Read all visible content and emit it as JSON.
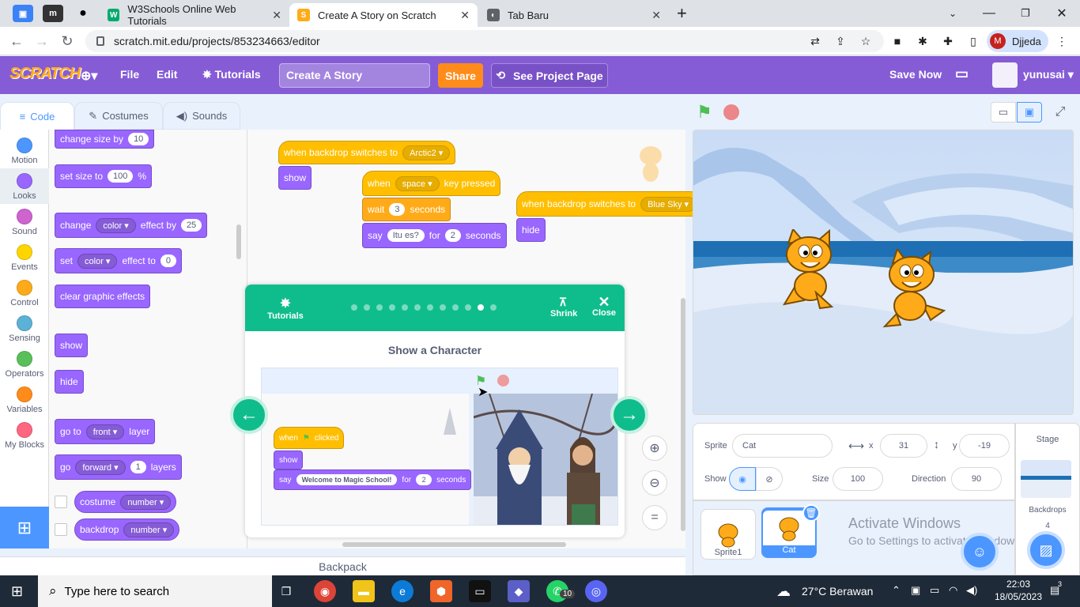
{
  "browser": {
    "tabs": [
      {
        "title": "W3Schools Online Web Tutorials",
        "fav": "W"
      },
      {
        "title": "Create A Story on Scratch",
        "fav": "S"
      },
      {
        "title": "Tab Baru",
        "fav": "◐"
      }
    ],
    "url": "scratch.mit.edu/projects/853234663/editor",
    "profile_initial": "M",
    "profile_name": "Djjeda"
  },
  "menubar": {
    "logo": "SCRATCH",
    "file": "File",
    "edit": "Edit",
    "tutorials": "Tutorials",
    "project_title": "Create A Story",
    "share": "Share",
    "see_project_page": "See Project Page",
    "save_now": "Save Now",
    "username": "yunusai"
  },
  "editor_tabs": {
    "code": "Code",
    "costumes": "Costumes",
    "sounds": "Sounds"
  },
  "categories": [
    {
      "label": "Motion",
      "color": "#4c97ff"
    },
    {
      "label": "Looks",
      "color": "#9966ff"
    },
    {
      "label": "Sound",
      "color": "#cf63cf"
    },
    {
      "label": "Events",
      "color": "#ffd500"
    },
    {
      "label": "Control",
      "color": "#ffab19"
    },
    {
      "label": "Sensing",
      "color": "#5cb1d6"
    },
    {
      "label": "Operators",
      "color": "#59c059"
    },
    {
      "label": "Variables",
      "color": "#ff8c1a"
    },
    {
      "label": "My Blocks",
      "color": "#ff6680"
    }
  ],
  "palette": {
    "change_size": {
      "text": "change size by",
      "value": "10"
    },
    "set_size": {
      "text": "set size to",
      "value": "100",
      "unit": "%"
    },
    "change_effect": {
      "a": "change",
      "drop": "color",
      "b": "effect by",
      "value": "25"
    },
    "set_effect": {
      "a": "set",
      "drop": "color",
      "b": "effect to",
      "value": "0"
    },
    "clear_effects": "clear graphic effects",
    "show": "show",
    "hide": "hide",
    "go_to": {
      "a": "go to",
      "drop": "front",
      "b": "layer"
    },
    "go_layers": {
      "a": "go",
      "drop": "forward",
      "value": "1",
      "b": "layers"
    },
    "costume": {
      "a": "costume",
      "drop": "number"
    },
    "backdrop": {
      "a": "backdrop",
      "drop": "number"
    }
  },
  "scripts": {
    "s1_hat": "when backdrop switches to",
    "s1_drop": "Arctic2",
    "s1_show": "show",
    "s2_when": "when",
    "s2_key": "space",
    "s2_pressed": "key pressed",
    "s2_wait": "wait",
    "s2_wait_val": "3",
    "s2_seconds": "seconds",
    "s2_say": "say",
    "s2_say_val": "Itu es?",
    "s2_for": "for",
    "s2_for_val": "2",
    "s2_seconds2": "seconds",
    "s3_hat": "when backdrop switches to",
    "s3_drop": "Blue Sky",
    "s3_hide": "hide"
  },
  "tutorial": {
    "tutorials_label": "Tutorials",
    "shrink_label": "Shrink",
    "close_label": "Close",
    "title": "Show a Character",
    "progress_total": 12,
    "progress_current": 11,
    "img_when": "when",
    "img_clicked": "clicked",
    "img_show": "show",
    "img_say": "say",
    "img_say_val": "Welcome to Magic School!",
    "img_for": "for",
    "img_for_val": "2",
    "img_seconds": "seconds"
  },
  "backpack": "Backpack",
  "sprite_info": {
    "sprite_label": "Sprite",
    "sprite_name": "Cat",
    "x_label": "x",
    "x_val": "31",
    "y_label": "y",
    "y_val": "-19",
    "show_label": "Show",
    "size_label": "Size",
    "size_val": "100",
    "direction_label": "Direction",
    "direction_val": "90"
  },
  "sprites": [
    {
      "name": "Sprite1"
    },
    {
      "name": "Cat"
    }
  ],
  "stage_panel": {
    "title": "Stage",
    "backdrops_label": "Backdrops",
    "backdrops_count": "4"
  },
  "watermark": {
    "line1": "Activate Windows",
    "line2": "Go to Settings to activate Windows."
  },
  "taskbar": {
    "search_placeholder": "Type here to search",
    "weather": "27°C  Berawan",
    "time": "22:03",
    "date": "18/05/2023",
    "notif_count": "3",
    "whatsapp_badge": "10"
  }
}
